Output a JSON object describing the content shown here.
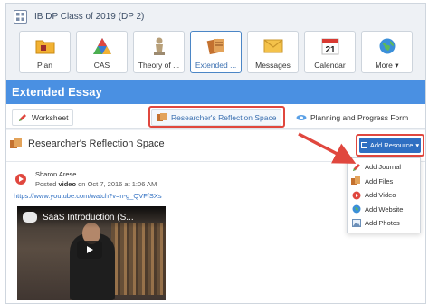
{
  "class_header": {
    "title": "IB DP Class of 2019 (DP 2)"
  },
  "nav_tiles": [
    {
      "label": "Plan",
      "icon": "folder-icon"
    },
    {
      "label": "CAS",
      "icon": "cas-triangle-icon"
    },
    {
      "label": "Theory of ...",
      "icon": "thinker-icon"
    },
    {
      "label": "Extended ...",
      "icon": "extended-essay-icon",
      "active": true
    },
    {
      "label": "Messages",
      "icon": "envelope-icon"
    },
    {
      "label": "Calendar",
      "icon": "calendar-icon",
      "day": "21"
    },
    {
      "label": "More",
      "icon": "globe-icon",
      "caret": "▾"
    }
  ],
  "banner": {
    "title": "Extended Essay"
  },
  "subtabs": [
    {
      "label": "Worksheet"
    },
    {
      "label": "Researcher's Reflection Space",
      "selected": true
    },
    {
      "label": "Planning and Progress Form"
    }
  ],
  "section": {
    "title": "Researcher's Reflection Space"
  },
  "add_resource": {
    "label": "Add Resource",
    "caret": "▾"
  },
  "resource_menu": [
    {
      "label": "Add Journal",
      "icon": "journal-icon"
    },
    {
      "label": "Add Files",
      "icon": "files-icon"
    },
    {
      "label": "Add Video",
      "icon": "video-icon"
    },
    {
      "label": "Add Website",
      "icon": "website-icon"
    },
    {
      "label": "Add Photos",
      "icon": "photos-icon"
    }
  ],
  "post": {
    "author": "Sharon Arese",
    "meta_prefix": "Posted",
    "meta_type": "video",
    "meta_suffix": "on Oct 7, 2016 at 1:06 AM",
    "link": "https://www.youtube.com/watch?v=n-g_QVFfSXs",
    "video_title": "SaaS Introduction (S..."
  },
  "colors": {
    "banner": "#4a90e2",
    "accent": "#2f6fc2",
    "highlight": "#e0473e"
  }
}
